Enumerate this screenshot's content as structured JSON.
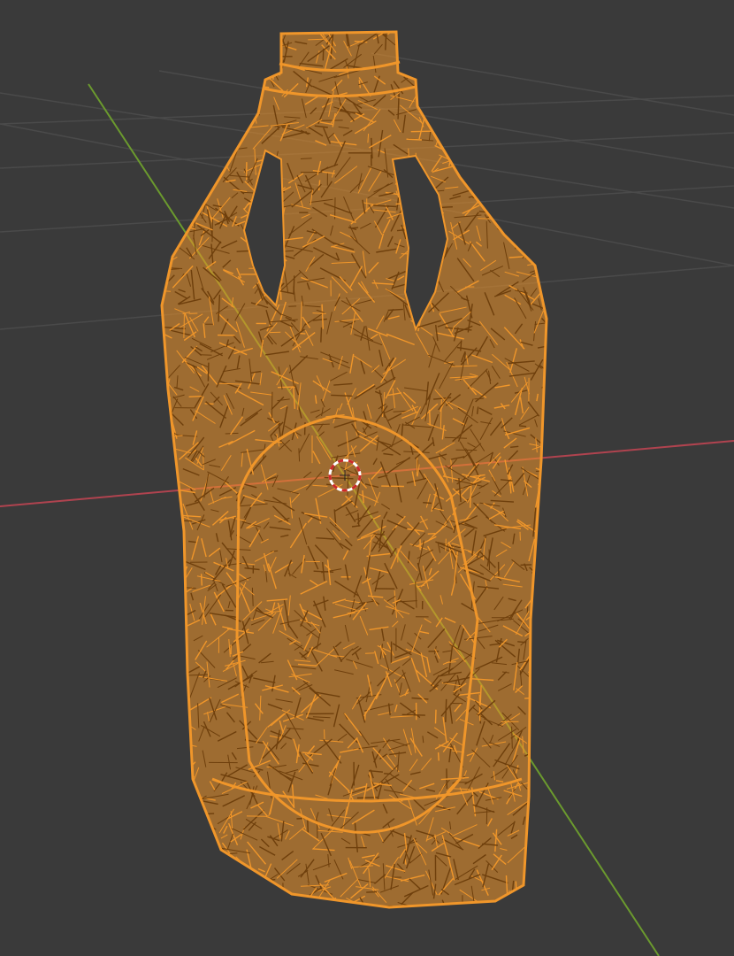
{
  "viewport": {
    "background_color": "#3a3a3a",
    "grid_color": "#4a4a4a",
    "x_axis_color": "#b0434f",
    "y_axis_color": "#6b9a2e"
  },
  "object": {
    "type": "bottle-mesh",
    "display_mode": "wireframe",
    "selected": true,
    "wire_color": "#f0962a",
    "edge_dark_color": "#6e3f0c"
  },
  "cursor_3d": {
    "visible": true,
    "ring_colors": [
      "#ffffff",
      "#cc2a2a"
    ]
  }
}
